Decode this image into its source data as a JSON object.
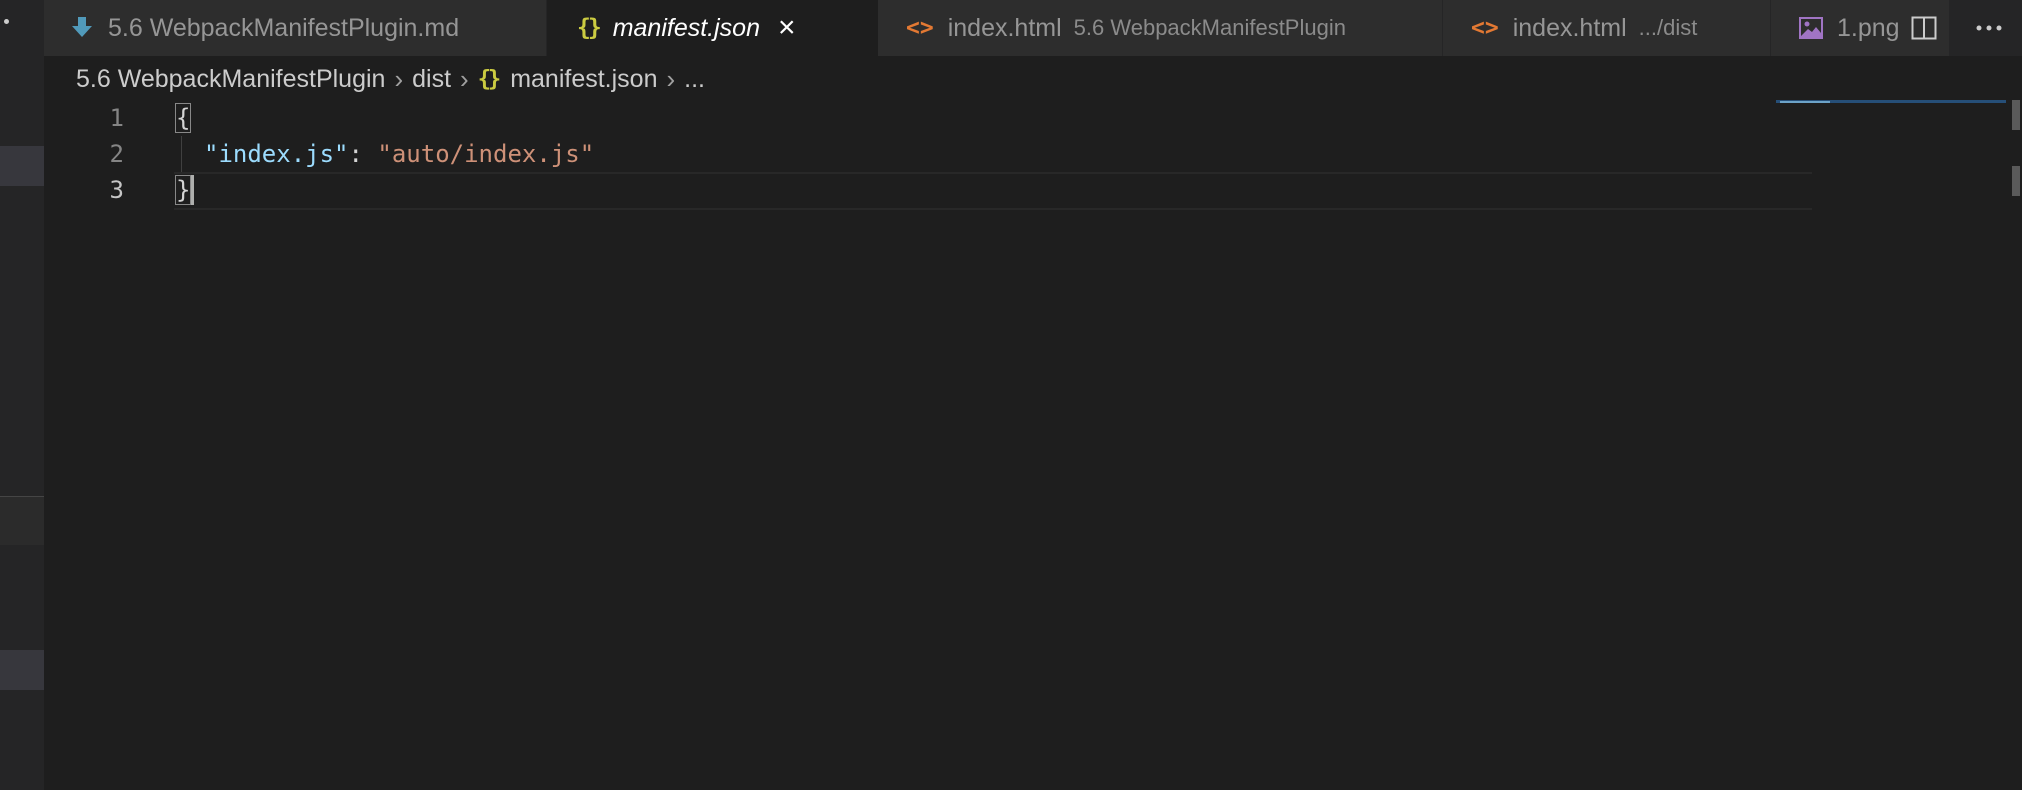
{
  "tabs": [
    {
      "icon": "markdown-download-icon",
      "name": "5.6 WebpackManifestPlugin.md",
      "description": "",
      "active": false
    },
    {
      "icon": "json-braces-icon",
      "icon_text": "{}",
      "name": "manifest.json",
      "description": "",
      "active": true
    },
    {
      "icon": "html-code-icon",
      "icon_text": "<>",
      "name": "index.html",
      "description": "5.6 WebpackManifestPlugin",
      "active": false
    },
    {
      "icon": "html-code-icon",
      "icon_text": "<>",
      "name": "index.html",
      "description": ".../dist",
      "active": false
    },
    {
      "icon": "image-file-icon",
      "name": "1.png",
      "description": "",
      "active": false
    }
  ],
  "breadcrumb": {
    "folder": "5.6 WebpackManifestPlugin",
    "subfolder": "dist",
    "file_icon": "{}",
    "file": "manifest.json",
    "more": "..."
  },
  "editor": {
    "lines": [
      {
        "number": "1",
        "text": "{"
      },
      {
        "number": "2",
        "key": "\"index.js\"",
        "colon": ": ",
        "value": "\"auto/index.js\""
      },
      {
        "number": "3",
        "text": "}"
      }
    ],
    "current_line": "3"
  },
  "colors": {
    "background": "#1e1e1e",
    "tab_bar": "#252526",
    "json_key": "#9cdcfe",
    "json_string": "#ce9178",
    "json_icon": "#cbcb41",
    "html_icon": "#e37933",
    "markdown_icon": "#519aba",
    "image_icon": "#a074c4"
  }
}
